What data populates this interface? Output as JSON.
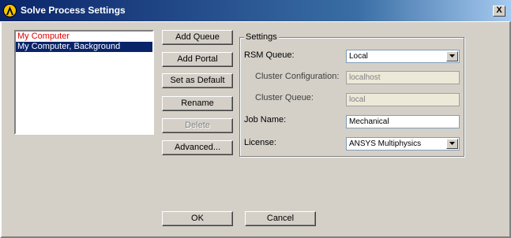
{
  "window": {
    "title": "Solve Process Settings",
    "close_label": "X"
  },
  "list": {
    "items": [
      "My Computer",
      "My Computer, Background"
    ]
  },
  "buttons": {
    "add_queue": "Add Queue",
    "add_portal": "Add Portal",
    "set_default": "Set as Default",
    "rename": "Rename",
    "delete": "Delete",
    "advanced": "Advanced...",
    "ok": "OK",
    "cancel": "Cancel"
  },
  "settings": {
    "group_title": "Settings",
    "rsm_queue_label": "RSM Queue:",
    "rsm_queue_value": "Local",
    "cluster_config_label": "Cluster Configuration:",
    "cluster_config_value": "localhost",
    "cluster_queue_label": "Cluster Queue:",
    "cluster_queue_value": "local",
    "job_name_label": "Job Name:",
    "job_name_value": "Mechanical",
    "license_label": "License:",
    "license_value": "ANSYS Multiphysics"
  },
  "icons": {
    "title": "ansys-logo-icon",
    "dropdown": "chevron-down-icon"
  },
  "colors": {
    "title_bar": "#0a246a",
    "selection": "#0a246a",
    "default_item_text": "#e00000",
    "dialog_bg": "#d4d0c8"
  }
}
